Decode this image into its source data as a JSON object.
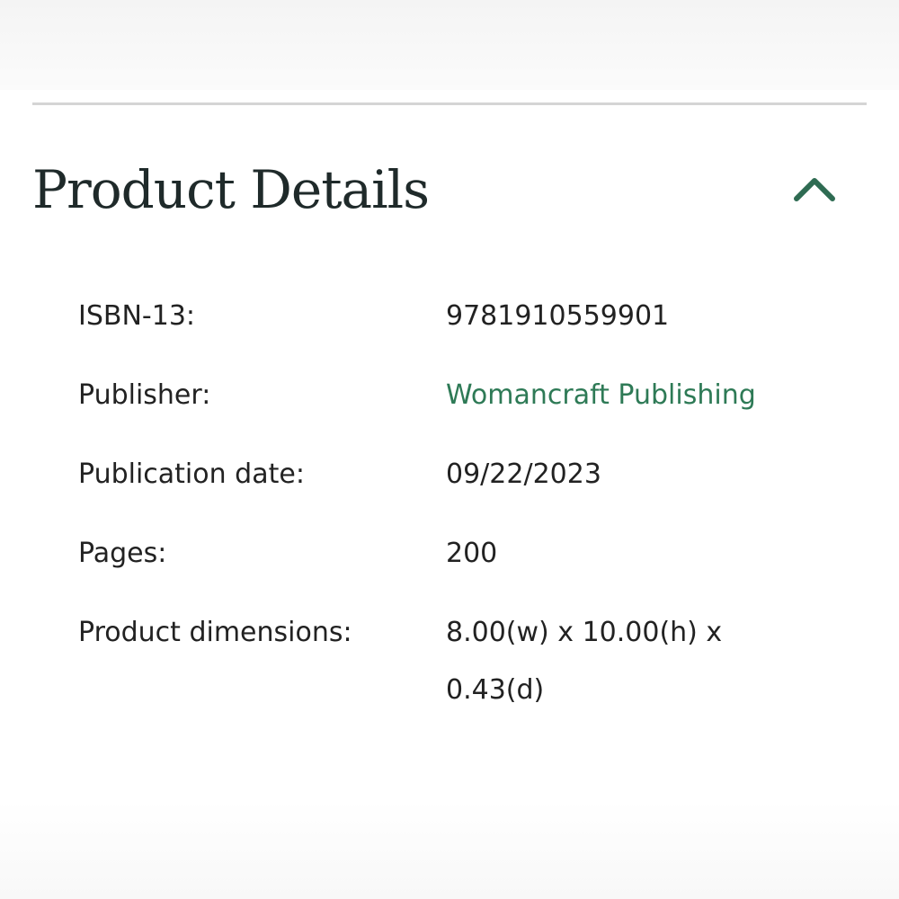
{
  "section": {
    "title": "Product Details",
    "toggle_icon": "chevron-up-icon",
    "accent_color": "#2e6b52"
  },
  "details": {
    "isbn": {
      "label": "ISBN-13:",
      "value": "9781910559901"
    },
    "publisher": {
      "label": "Publisher:",
      "value": "Womancraft Publishing",
      "link_color": "#2e7a56"
    },
    "publication_date": {
      "label": "Publication date:",
      "value": "09/22/2023"
    },
    "pages": {
      "label": "Pages:",
      "value": "200"
    },
    "dimensions": {
      "label": "Product dimensions:",
      "value": "8.00(w) x 10.00(h) x 0.43(d)"
    }
  }
}
